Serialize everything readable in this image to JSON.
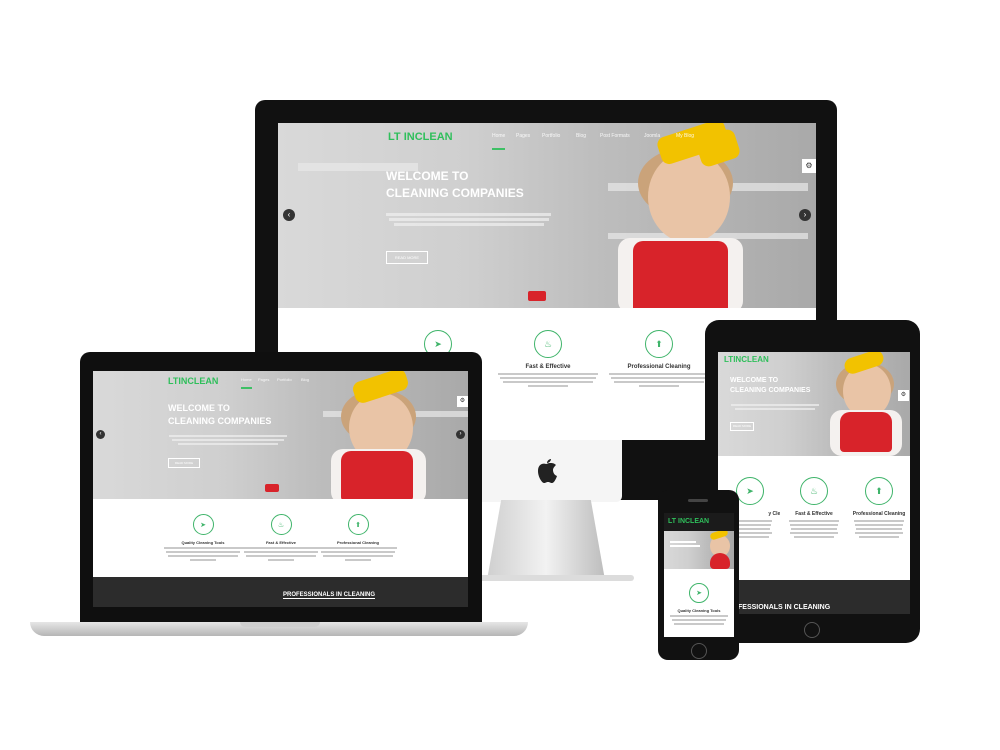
{
  "brand": {
    "logo_lt": "LT",
    "logo_name": "INCLEAN",
    "accent": "#2fbf5b",
    "red": "#d8232a",
    "yellow": "#f2c200"
  },
  "nav": {
    "items": [
      "Home",
      "Pages",
      "Portfolio",
      "Blog",
      "Post Formats",
      "Joomla",
      "My Blog"
    ]
  },
  "hero": {
    "title_line1": "WELCOME TO",
    "title_line2": "CLEANING COMPANIES",
    "button": "READ MORE"
  },
  "features": [
    {
      "title": "Quality Cleaning Tools",
      "icon": "paper-plane-icon"
    },
    {
      "title": "Fast & Effective",
      "icon": "spray-bottle-icon"
    },
    {
      "title": "Professional Cleaning",
      "icon": "bucket-icon"
    }
  ],
  "band": {
    "title": "PROFESSIONALS IN CLEANING",
    "tablet_title": "FESSIONALS IN CLEANING"
  },
  "feature_text": "Lorem ipsum dolor sit amet, consectetuer adipiscing elit, sed diam nonummy nibh euismod tincidunt ut laoreet dolore. Phasellus viverra nulla ut metus varius laoreet. Quisque rutrum."
}
